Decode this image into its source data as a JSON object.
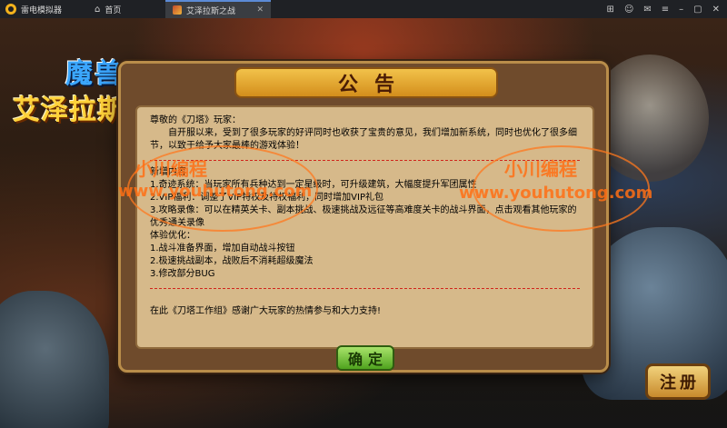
{
  "titlebar": {
    "app_name": "雷电模拟器",
    "tabs": [
      {
        "label": "首页"
      },
      {
        "label": "艾泽拉斯之战"
      }
    ]
  },
  "logo": {
    "top": "魔兽",
    "main": "艾泽拉斯"
  },
  "notice": {
    "title": "公告",
    "greeting": "尊敬的《刀塔》玩家：",
    "intro": "自开服以来，受到了很多玩家的好评同时也收获了宝贵的意见，我们增加新系统，同时也优化了很多细节，以致于给予大家最棒的游戏体验！",
    "new_content_heading": "新增内容",
    "new_items": [
      "1.奇迹系统：当玩家所有兵种达到一定星级时，可升级建筑，大幅度提升军团属性",
      "2.VIP福利：调整了VIP特权及特权福利，同时增加VIP礼包",
      "3.攻略录像：可以在精英关卡、副本挑战、极速挑战及远征等高难度关卡的战斗界面，点击观看其他玩家的优秀通关录像"
    ],
    "optimization_heading": "体验优化：",
    "optimization_items": [
      "1.战斗准备界面，增加自动战斗按钮",
      "2.极速挑战副本，战败后不消耗超级魔法",
      "3.修改部分BUG"
    ],
    "closing": "在此《刀塔工作组》感谢广大玩家的热情参与和大力支持!",
    "confirm_label": "确定"
  },
  "register_label": "注册",
  "watermark": {
    "name": "小川编程",
    "url": "www.youhutong.com"
  }
}
